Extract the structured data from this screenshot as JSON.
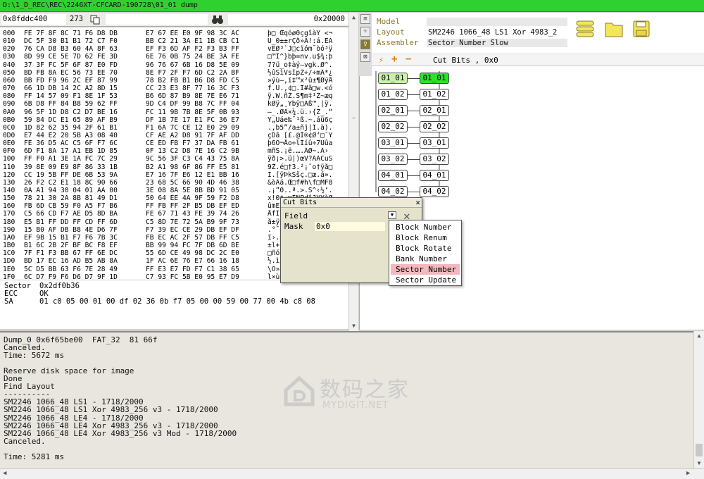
{
  "window": {
    "title": "D:\\1_D_REC\\REC\\2246XT-CFCARD-190728\\01_01 dump"
  },
  "hex_toolbar": {
    "offset": "0x8fddc400",
    "sector_count": "273",
    "end_offset": "0x20000"
  },
  "hex_rows": [
    {
      "off": "000",
      "b1": "FE 7F 8F 8C 71 F6 D8 DB",
      "b2": "E7 67 EE E0 9F 98 3C AC",
      "a": "þ□ Œqöø0çgîàŸ <¬"
    },
    {
      "off": "010",
      "b1": "DC 5F 30 B1 B1 72 C7 F0",
      "b2": "BB C2 21 3A E1 1B CB C1",
      "a": "Ü_0±±rÇð»Â!:á.ËÁ"
    },
    {
      "off": "020",
      "b1": "76 CA D8 B3 60 4A 8F 63",
      "b2": "EF F3 6D AF F2 F3 B3 FF",
      "a": "vÊØ³`J□cïóm¯òó³ÿ"
    },
    {
      "off": "030",
      "b1": "8D 99 CE 5E 7D 62 FE 3D",
      "b2": "6E 76 0B 75 24 BE 3A FE",
      "a": "□™Î^}bþ=nv.u$¾:þ"
    },
    {
      "off": "040",
      "b1": "37 3F FC 5F 6F 87 E0 FD",
      "b2": "96 76 67 6B 16 D8 5E 09",
      "a": "7?ü_o‡àý–vgk.Ø^."
    },
    {
      "off": "050",
      "b1": "BD FB 8A EC 56 73 EE 70",
      "b2": "8E F7 2F F7 6D C2 2A BF",
      "a": "½ûŠìVsîpŽ÷/÷mÂ*¿"
    },
    {
      "off": "060",
      "b1": "BB FD F9 96 2C EF 87 99",
      "b2": "78 B2 FB B1 B6 D8 FD C5",
      "a": "»ýù–,ï‡™x²û±¶ØýÅ"
    },
    {
      "off": "070",
      "b1": "66 1D DB 14 2C A2 8D 15",
      "b2": "CC 23 E3 8F 77 16 3C F3",
      "a": "f.Û.,¢□.Ì#ã□w.<ó"
    },
    {
      "off": "080",
      "b1": "FF 14 57 09 F1 8E 1F 53",
      "b2": "B6 6D 87 B9 8E 7E E6 71",
      "a": "ÿ.W.ñŽ.S¶m‡¹Ž~æq"
    },
    {
      "off": "090",
      "b1": "6B D8 FF 84 B8 59 62 FF",
      "b2": "9D C4 DF 99 B8 7C FF 04",
      "a": "kØÿ„¸Ybÿ□Äß™¸|ÿ."
    },
    {
      "off": "0A0",
      "b1": "96 5F 1D D8 C2 D7 BE 16",
      "b2": "FC 11 9B 7B 8E 5F 0B 93",
      "a": "–_.ØÂ×¾.ü.›{Ž_.“"
    },
    {
      "off": "0B0",
      "b1": "59 84 DC E1 65 89 AF B9",
      "b2": "DF 1B 7E 17 E1 FC 36 E7",
      "a": "Y„Üáe‰¯¹ß.~.áü6ç"
    },
    {
      "off": "0C0",
      "b1": "1D 82 62 35 94 2F 61 B1",
      "b2": "F1 6A 7C CE 12 E0 29 09",
      "a": ".‚b5”/a±ñj|Î.à)."
    },
    {
      "off": "0D0",
      "b1": "E7 44 E2 20 5B A3 08 40",
      "b2": "CF AE A2 D8 91 7F AF DD",
      "a": "çDâ [£.@Ï®¢Ø‘□¯Ý"
    },
    {
      "off": "0E0",
      "b1": "FE 36 D5 AC C5 6F F7 6C",
      "b2": "CE ED FB F7 37 DA FB 61",
      "a": "þ6Õ¬Åo÷lÎíû÷7Úûa"
    },
    {
      "off": "0F0",
      "b1": "6D F1 8A 17 A1 EB 1D 85",
      "b2": "0F 13 C2 D8 7E 16 C2 9B",
      "a": "mñŠ.¡ë.….ÂØ~.Â›"
    },
    {
      "off": "100",
      "b1": "FF F0 A1 3E 1A FC 7C 29",
      "b2": "9C 56 3F C3 C4 43 75 8A",
      "a": "ÿð¡>.ü|)œV?ÃÄCuŠ"
    },
    {
      "off": "110",
      "b1": "39 8E 09 E9 8F 86 33 1B",
      "b2": "B2 A1 98 6F 86 FF E5 81",
      "a": "9Ž.é□†3.²¡˜o†ÿå□"
    },
    {
      "off": "120",
      "b1": "CC 19 5B FF DE 6B 53 9A",
      "b2": "E7 16 7F E6 12 E1 BB 16",
      "a": "Ì.[ÿÞkSšç.□æ.á»."
    },
    {
      "off": "130",
      "b1": "26 F2 C2 E1 18 8C 90 66",
      "b2": "23 68 5C 66 90 4D 46 38",
      "a": "&òÂá.Œ□f#h\\f□MF8"
    },
    {
      "off": "140",
      "b1": "0A A1 94 30 04 01 AA 00",
      "b2": "3E 08 8A 5E 8B BD 91 05",
      "a": ".¡”0..ª.>.Š^‹½‘."
    },
    {
      "off": "150",
      "b1": "78 21 30 2A 8B 81 49 D1",
      "b2": "50 64 EE 4A 9F 59 F2 D8",
      "a": "x!0*‹□IÑPdîJŸYòØ"
    },
    {
      "off": "160",
      "b1": "FB 6D CB 59 F0 A5 F7 B6",
      "b2": "FF FB FF 2F B5 DB EF ED",
      "a": "ûmËYð¥÷¶ÿûÿ/µÛïí"
    },
    {
      "off": "170",
      "b1": "C5 66 CD F7 AE D5 8D BA",
      "b2": "FE 67 71 43 FE 39 74 26",
      "a": "ÅfÍ÷®Õ□ºþgqCþ9t&"
    },
    {
      "off": "180",
      "b1": "E5 B1 FF DD FF CD FF 6D",
      "b2": "C5 8D 7E 72 5A B9 9F 73",
      "a": "å±ÿÝÿÍÿmÅ□~rZ¹Ÿs"
    },
    {
      "off": "190",
      "b1": "15 B0 AF DB B8 4E D6 7F",
      "b2": "F7 39 EC CE 29 DB EF DF",
      "a": ".°¯Û¸NÖ□÷9ìÎ)Ûïß"
    },
    {
      "off": "1A0",
      "b1": "EF 9B 15 B1 F7 F6 7B 3C",
      "b2": "FB EC AC 2F 57 DB FF C5",
      "a": "ï›.±÷ö{<ûì¬/WÛÿÅ"
    },
    {
      "off": "1B0",
      "b1": "B1 6C 2B 2F BF BC F8 EF",
      "b2": "BB 99 94 FC 7F DB 6D BE",
      "a": "±l+/¿¼øï»™”ü□Ûm¾"
    },
    {
      "off": "1C0",
      "b1": "7F F1 F3 BB 67 FF 6E DC",
      "b2": "55 6D CE 49 98 DC 2C E0",
      "a": "□ñó»gÿnÜUmÎI˜Ü,à"
    },
    {
      "off": "1D0",
      "b1": "BD 17 EC 16 AD B5 AB 8A",
      "b2": "1F AC 6E 76 E7 66 16 18",
      "a": "½.ì.­µ«Š.¬nvçf.."
    },
    {
      "off": "1E0",
      "b1": "5C D5 BB 63 F6 7E 28 49",
      "b2": "FF E3 E7 FD F7 C1 38 65",
      "a": "\\Õ»cö~(Iÿãçý÷Á8e"
    },
    {
      "off": "1F0",
      "b1": "6C D7 F9 F6 D6 D7 9F 1D",
      "b2": "C7 93 FC 5B E0 95 E7 D9",
      "a": "l×ùöÖ×Ÿ.Ç“ü[à•çÙ"
    }
  ],
  "sector_info": {
    "sector_label": "Sector",
    "sector_value": "0x2df0b36",
    "ecc_label": "ECC",
    "ecc_value": "OK",
    "sa_label": "SA",
    "sa_value": "01 c0 05 00 01 00 df 02 36 0b f7 05 00 00 59 00 77 00 4b c8 08"
  },
  "props": {
    "model_label": "Model",
    "model_value": "",
    "layout_label": "Layout",
    "layout_value": "SM2246 1066_48 LS1 Xor 4983_2",
    "assembler_label": "Assembler",
    "assembler_value": "Sector Number Slow"
  },
  "cutbits_bar": {
    "label": "Cut Bits , 0x0",
    "add": "+",
    "remove": "−"
  },
  "nodes": {
    "left": [
      "01_01",
      "01_02",
      "02_01",
      "02_02",
      "03_01",
      "03_02",
      "04_01",
      "04_02"
    ],
    "right": [
      "01_01",
      "01_02",
      "02_01",
      "02_02",
      "03_01",
      "03_02",
      "04_01",
      "04_02"
    ]
  },
  "dialog": {
    "title": "Cut Bits",
    "field_label": "Field",
    "mask_label": "Mask",
    "mask_value": "0x0"
  },
  "dropdown": {
    "items": [
      "Block Number",
      "Block Renum",
      "Block Rotate",
      "Bank Number",
      "Sector Number",
      "Sector Update"
    ],
    "highlighted": 4
  },
  "log_lines": [
    "Dump_0 0x6f65be00  FAT_32  81 66f",
    "Canceled.",
    "Time: 5672 ms",
    "",
    "Reserve disk space for image",
    "Done",
    "Find Layout",
    "----------",
    "SM2246 1066_48 LS1 - 1718/2000",
    "SM2246 1066_48 LS1 Xor 4983_256 v3 - 1718/2000",
    "SM2246 1066_48 LE4 - 1718/2000",
    "SM2246 1066_48 LE4 Xor 4983_256 v3 - 1718/2000",
    "SM2246 1066_48 LE4 Xor 4983_256 v3 Mod - 1718/2000",
    "Canceled.",
    "",
    "Time: 5281 ms"
  ],
  "watermark": {
    "cn": "数码之家",
    "en": "MYDIGIT.NET"
  }
}
